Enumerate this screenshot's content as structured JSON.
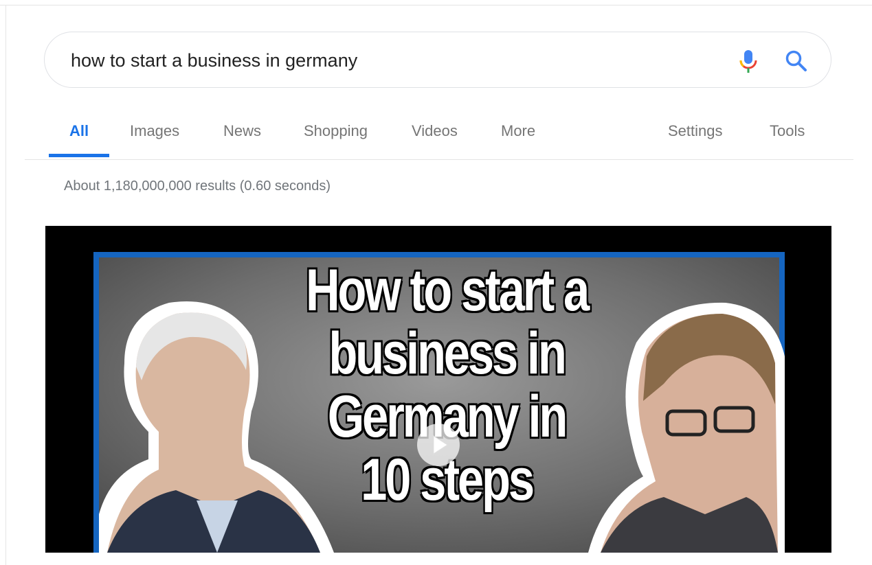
{
  "search": {
    "query": "how to start a business in germany",
    "icons": {
      "mic": "mic-icon",
      "search": "search-icon"
    },
    "colors": {
      "mic_blue": "#4285f4",
      "mic_red": "#ea4335",
      "mic_yellow": "#fbbc05",
      "mic_green": "#34a853",
      "search_blue": "#4285f4"
    }
  },
  "tabs": {
    "items": [
      {
        "label": "All",
        "active": true
      },
      {
        "label": "Images"
      },
      {
        "label": "News"
      },
      {
        "label": "Shopping"
      },
      {
        "label": "Videos"
      },
      {
        "label": "More"
      }
    ],
    "settings": "Settings",
    "tools": "Tools",
    "active_color": "#1a73e8"
  },
  "results": {
    "stats": "About 1,180,000,000 results (0.60 seconds)"
  },
  "video": {
    "thumbnail_text_lines": [
      "How to start a",
      "business in",
      "Germany in",
      "10 steps"
    ],
    "play_icon": "play-icon",
    "border_color": "#1565c0"
  }
}
